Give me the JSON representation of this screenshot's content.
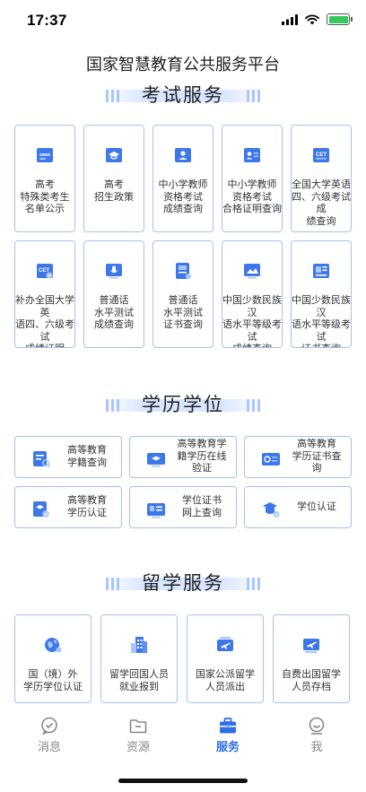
{
  "status": {
    "time": "17:37"
  },
  "page": {
    "title": "国家智慧教育公共服务平台"
  },
  "colors": {
    "accent": "#2d6de8",
    "border": "#a7c1ec",
    "inactive": "#888888"
  },
  "sections": {
    "exam": {
      "title": "考试服务",
      "items": [
        {
          "icon": "notice-card-icon",
          "label": "高考\n特殊类考生\n名单公示"
        },
        {
          "icon": "graduation-cap-icon",
          "label": "高考\n招生政策"
        },
        {
          "icon": "teacher-id-icon",
          "label": "中小学教师\n资格考试\n成绩查询"
        },
        {
          "icon": "teacher-certificate-icon",
          "label": "中小学教师\n资格考试\n合格证明查询"
        },
        {
          "icon": "cet-icon",
          "label": "全国大学英语\n四、六级考试成\n绩查询",
          "text": "CET"
        },
        {
          "icon": "cet-certificate-icon",
          "label": "补办全国大学英\n语四、六级考试\n成绩证明",
          "text": "CET"
        },
        {
          "icon": "microphone-screen-icon",
          "label": "普通话\n水平测试\n成绩查询"
        },
        {
          "icon": "mandarin-certificate-icon",
          "label": "普通话\n水平测试\n证书查询"
        },
        {
          "icon": "minority-language-score-icon",
          "label": "中国少数民族汉\n语水平等级考试\n成绩查询"
        },
        {
          "icon": "minority-language-certificate-icon",
          "label": "中国少数民族汉\n语水平等级考试\n证书查询"
        }
      ]
    },
    "degree": {
      "title": "学历学位",
      "items": [
        {
          "icon": "student-status-search-icon",
          "label": "高等教育\n学籍查询"
        },
        {
          "icon": "online-verification-icon",
          "label": "高等教育学\n籍学历在线\n验证"
        },
        {
          "icon": "diploma-search-icon",
          "label": "高等教育\n学历证书查\n询"
        },
        {
          "icon": "diploma-authentication-icon",
          "label": "高等教育\n学历认证"
        },
        {
          "icon": "degree-certificate-online-icon",
          "label": "学位证书\n网上查询"
        },
        {
          "icon": "degree-authentication-icon",
          "label": "学位认证"
        }
      ]
    },
    "study_abroad": {
      "title": "留学服务",
      "items": [
        {
          "icon": "globe-icon",
          "label": "国（境）外\n学历学位认证"
        },
        {
          "icon": "office-building-icon",
          "label": "留学回国人员\n就业报到"
        },
        {
          "icon": "plane-dispatch-icon",
          "label": "国家公派留学\n人员派出"
        },
        {
          "icon": "plane-archive-icon",
          "label": "自费出国留学\n人员存档"
        }
      ]
    }
  },
  "tabs": [
    {
      "key": "messages",
      "icon": "message-check-icon",
      "label": "消息",
      "active": false
    },
    {
      "key": "resources",
      "icon": "folder-icon",
      "label": "资源",
      "active": false
    },
    {
      "key": "services",
      "icon": "briefcase-icon",
      "label": "服务",
      "active": true
    },
    {
      "key": "me",
      "icon": "user-smile-icon",
      "label": "我",
      "active": false
    }
  ]
}
